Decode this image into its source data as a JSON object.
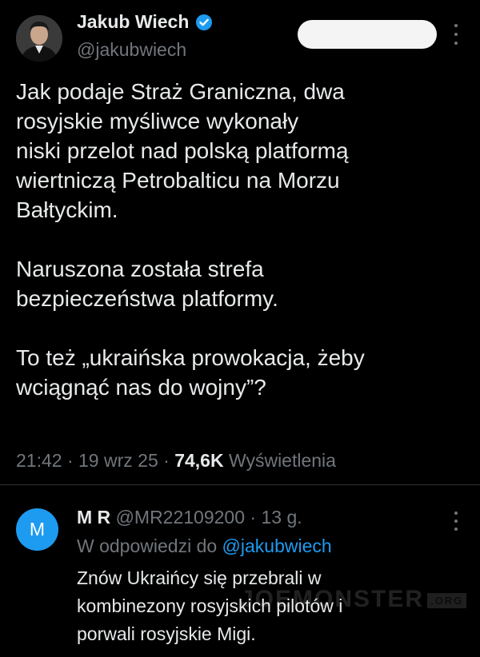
{
  "tweet": {
    "author_name": "Jakub Wiech",
    "author_handle": "@jakubwiech",
    "text_lines": [
      "Jak podaje Straż Graniczna, dwa",
      "rosyjskie myśliwce wykonały",
      "niski przelot nad polską platformą",
      "wiertniczą Petrobalticu na Morzu",
      "Bałtyckim.",
      "",
      "Naruszona została strefa",
      "bezpieczeństwa platformy.",
      "",
      "To też „ukraińska prowokacja, żeby",
      "wciągnąć nas do wojny”?"
    ],
    "time": "21:42",
    "date": "19 wrz 25",
    "views_count": "74,6K",
    "views_label": "Wyświetlenia"
  },
  "reply": {
    "avatar_letter": "M",
    "author_name": "M R",
    "author_handle": "@MR22109200",
    "age": "13 g.",
    "replying_to_label": "W odpowiedzi do",
    "replying_to_handle": "@jakubwiech",
    "text_lines": [
      "Znów Ukraińcy się przebrali w",
      "kombinezony rosyjskich pilotów i",
      "porwali rosyjskie Migi."
    ]
  },
  "watermark": {
    "text": "JOEMONSTER",
    "suffix": ".ORG"
  },
  "colors": {
    "background": "#000000",
    "text_primary": "#e7e9ea",
    "text_secondary": "#71767b",
    "accent": "#1d9bf0"
  }
}
